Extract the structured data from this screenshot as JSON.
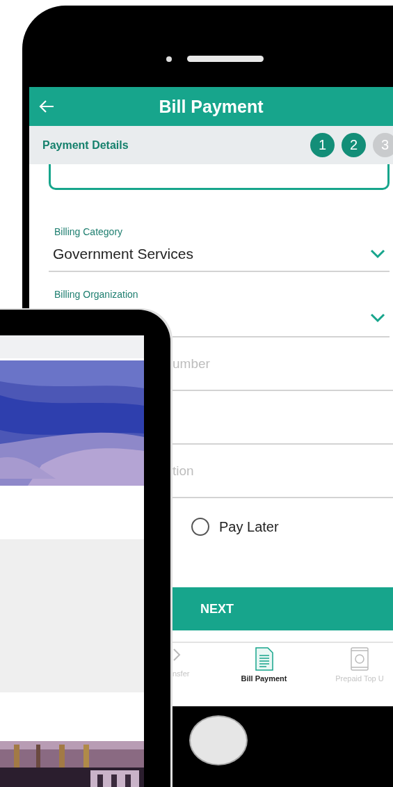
{
  "header": {
    "title": "Bill Payment"
  },
  "section": {
    "title": "Payment Details"
  },
  "steps": [
    {
      "label": "1",
      "done": true
    },
    {
      "label": "2",
      "done": true
    },
    {
      "label": "3",
      "done": false
    }
  ],
  "fields": [
    {
      "kind": "select",
      "label": "Billing Category",
      "value": "Government Services"
    },
    {
      "kind": "select",
      "label": "Billing Organization"
    },
    {
      "kind": "text",
      "placeholder": "umber"
    },
    {
      "kind": "text"
    },
    {
      "kind": "text",
      "placeholder": "tion"
    }
  ],
  "pay_later": {
    "label": "Pay Later",
    "selected": false
  },
  "next_button": {
    "label": "NEXT"
  },
  "bottom_nav": [
    {
      "label": "nsfer",
      "selected": false
    },
    {
      "label": "Bill Payment",
      "selected": true
    },
    {
      "label": "Prepaid Top U",
      "selected": false
    }
  ]
}
